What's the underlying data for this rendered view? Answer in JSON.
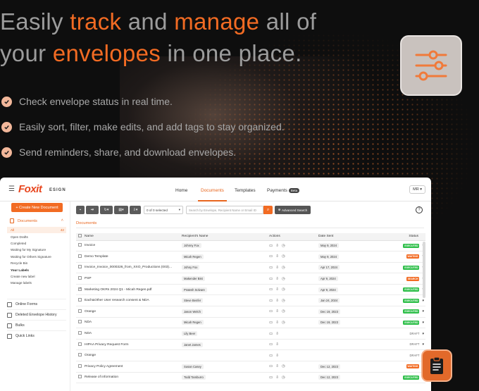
{
  "headline": {
    "part1": "Easily ",
    "hl1": "track",
    "part2": " and ",
    "hl2": "manage",
    "part3": " all of your ",
    "hl3": "envelopes",
    "part4": " in one place."
  },
  "bullets": [
    "Check envelope status in real time.",
    "Easily sort, filter, make edits, and add tags to stay organized.",
    "Send reminders, share, and download envelopes."
  ],
  "colors": {
    "accent": "#f26b23",
    "completed": "#2fbf4a",
    "pending": "#f26b23"
  },
  "app": {
    "logo": "Foxit",
    "logo_sub": "ESIGN",
    "nav": [
      "Home",
      "Documents",
      "Templates",
      "Payments"
    ],
    "beta": "Beta",
    "user": "MR",
    "new_document": "+ Create New Document",
    "documents_label": "Documents",
    "side_items": [
      {
        "label": "All",
        "count": "42"
      },
      {
        "label": "Open Drafts",
        "count": ""
      },
      {
        "label": "Completed",
        "count": ""
      },
      {
        "label": "Waiting for My Signature",
        "count": ""
      },
      {
        "label": "Waiting for Others Signature",
        "count": ""
      },
      {
        "label": "Recycle Bin",
        "count": ""
      },
      {
        "label": "Your Labels",
        "count": ""
      },
      {
        "label": "Create new label",
        "count": ""
      },
      {
        "label": "Manage labels",
        "count": ""
      }
    ],
    "side_sections": [
      "Online Forms",
      "Deleted Envelope History",
      "Bulks",
      "Quick Links"
    ],
    "selection": "0 of 0 selected",
    "search_placeholder": "Search by Envelope, Recipient Name or Email ID",
    "advanced_search": "Advanced Search",
    "tab": "Documents",
    "columns": [
      "Name",
      "Recipient's Name",
      "Actions",
      "Date Sent",
      "Status"
    ],
    "rows": [
      {
        "name": "Invoice",
        "recipient": "Johnny Fox",
        "date": "May 9, 2024",
        "status": "EXECUTED",
        "checked": false
      },
      {
        "name": "Demo Template",
        "recipient": "Micah Regen",
        "date": "May 9, 2024",
        "status": "WAITING",
        "checked": false
      },
      {
        "name": "Invoice_Invoice_0000326_from_XXO_Productions (003)...",
        "recipient": "Johny Fox",
        "date": "Apr 17, 2024",
        "status": "EXECUTED",
        "checked": false
      },
      {
        "name": "PSP",
        "recipient": "Makender Bist",
        "date": "Apr 9, 2024",
        "status": "SEARCH",
        "checked": false
      },
      {
        "name": "Marketing OKRs 2024 Q1 - Micah Regen.pdf",
        "recipient": "Pratesh Solvare",
        "date": "Apr 9, 2024",
        "status": "EXECUTED",
        "checked": true
      },
      {
        "name": "Each&Other User research consent & NDA",
        "recipient": "Steve Benfer",
        "date": "Jan 24, 2024",
        "status": "EXECUTED",
        "checked": false
      },
      {
        "name": "Orange",
        "recipient": "Jason Welch",
        "date": "Dec 19, 2023",
        "status": "EXECUTED",
        "checked": false
      },
      {
        "name": "NDA",
        "recipient": "Micah Regen",
        "date": "Dec 19, 2023",
        "status": "EXECUTED",
        "checked": false
      },
      {
        "name": "NDA",
        "recipient": "Lily Beer",
        "date": "",
        "status": "DRAFT",
        "checked": false
      },
      {
        "name": "HIPAA Privacy Request Form",
        "recipient": "Janet James",
        "date": "",
        "status": "DRAFT",
        "checked": false
      },
      {
        "name": "Orange",
        "recipient": "",
        "date": "",
        "status": "DRAFT",
        "checked": false
      },
      {
        "name": "Privacy Policy Agreement",
        "recipient": "Susan Casey",
        "date": "Dec 12, 2023",
        "status": "WAITING",
        "checked": false
      },
      {
        "name": "Release of information",
        "recipient": "Todd Tamburro",
        "date": "Dec 12, 2023",
        "status": "EXECUTED",
        "checked": false
      }
    ]
  }
}
